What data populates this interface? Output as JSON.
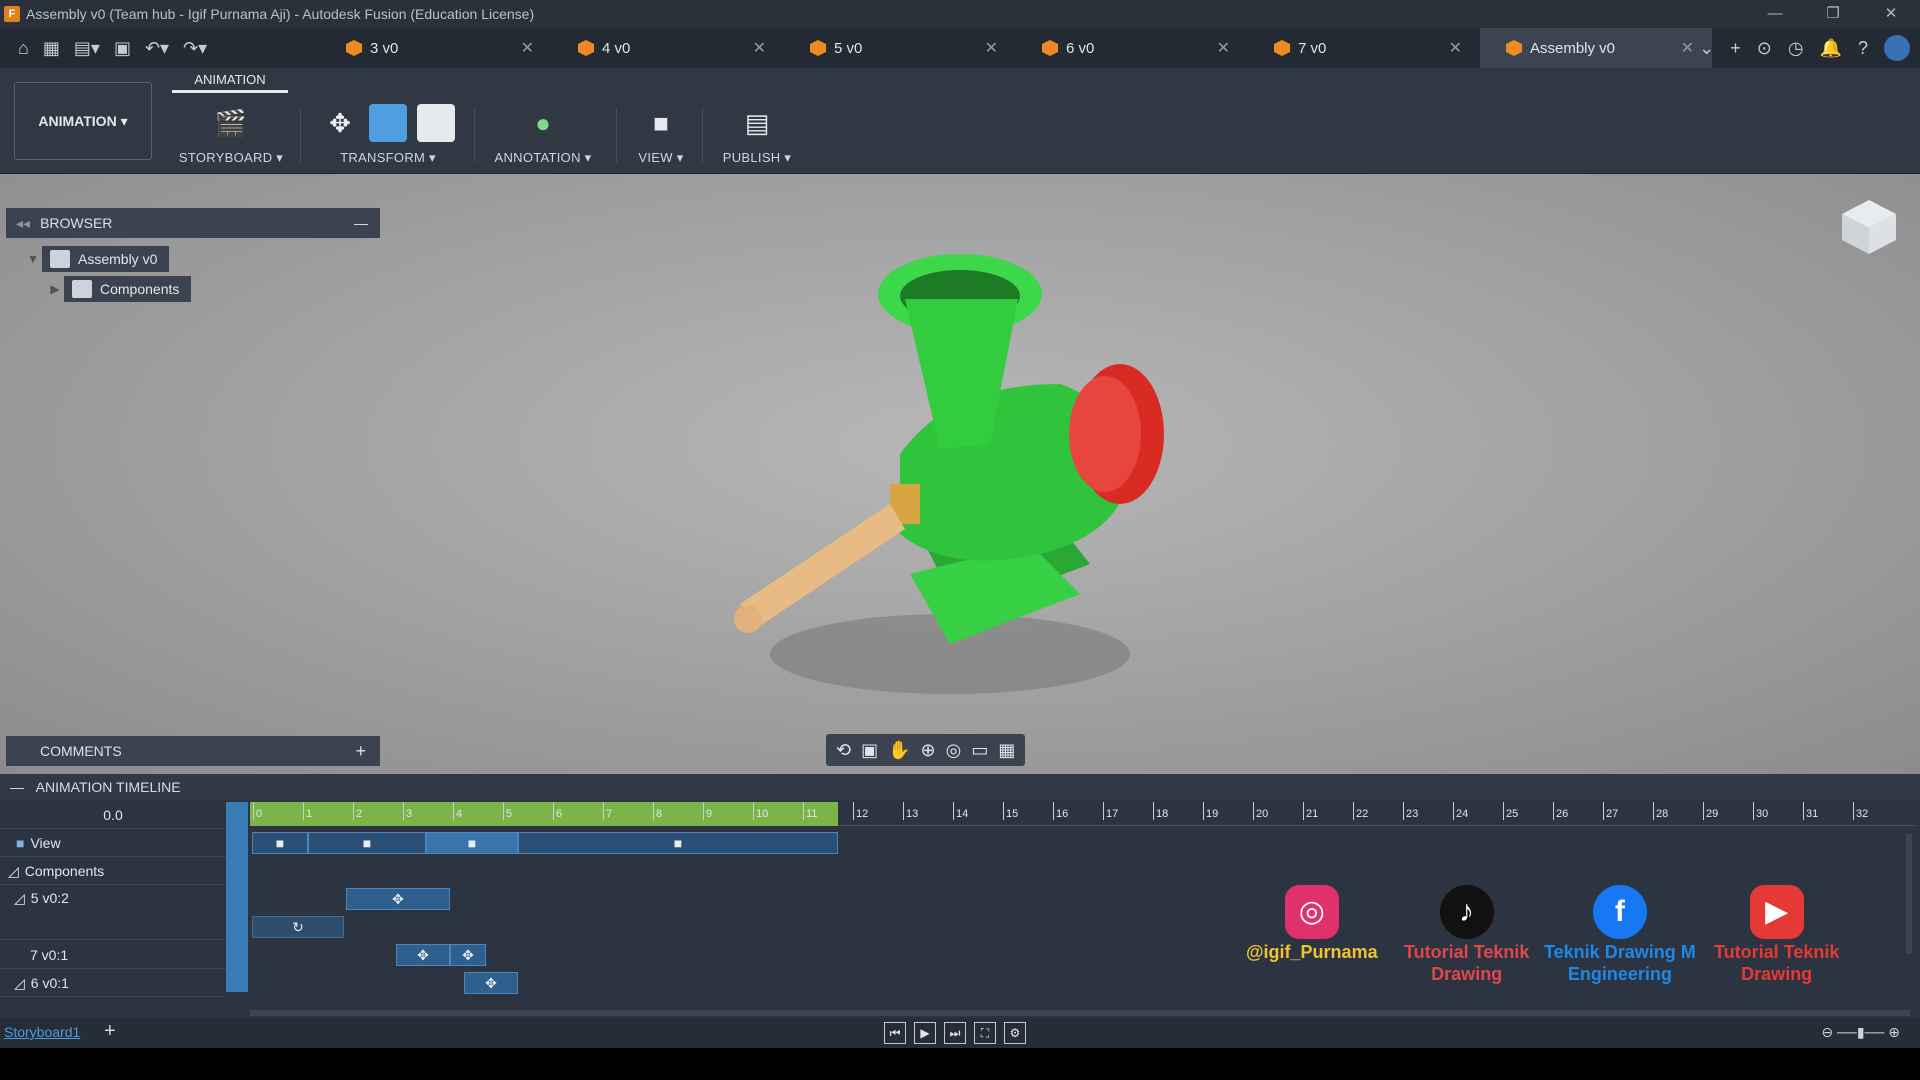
{
  "window": {
    "title": "Assembly v0 (Team hub - Igif Purnama Aji) - Autodesk Fusion (Education License)",
    "controls": [
      "—",
      "❐",
      "✕"
    ]
  },
  "tabs": [
    {
      "label": "3 v0",
      "active": false
    },
    {
      "label": "4 v0",
      "active": false
    },
    {
      "label": "5 v0",
      "active": false
    },
    {
      "label": "6 v0",
      "active": false
    },
    {
      "label": "7 v0",
      "active": false
    },
    {
      "label": "Assembly v0",
      "active": true
    }
  ],
  "ribbon": {
    "workspace": "ANIMATION",
    "active_tab": "ANIMATION",
    "groups": {
      "storyboard": "STORYBOARD",
      "transform": "TRANSFORM",
      "annotation": "ANNOTATION",
      "view": "VIEW",
      "publish": "PUBLISH"
    }
  },
  "browser": {
    "title": "BROWSER",
    "root": "Assembly v0",
    "child": "Components"
  },
  "comments": {
    "title": "COMMENTS",
    "add": "+"
  },
  "timeline": {
    "title": "ANIMATION TIMELINE",
    "time": "0.0",
    "rows": {
      "view": "View",
      "components": "Components",
      "c1": "5 v0:2",
      "c2": "7 v0:1",
      "c3": "6 v0:1"
    },
    "ruler_ticks": [
      "0",
      "1",
      "2",
      "3",
      "4",
      "5",
      "6",
      "7",
      "8",
      "9",
      "10",
      "11",
      "12",
      "13",
      "14",
      "15",
      "16",
      "17",
      "18",
      "19",
      "20",
      "21",
      "22",
      "23",
      "24",
      "25",
      "26",
      "27",
      "28",
      "29",
      "30",
      "31",
      "32"
    ],
    "storyboard": "Storyboard1"
  },
  "social": {
    "instagram": "@igif_Purnama",
    "tiktok_1": "Tutorial Teknik",
    "tiktok_2": "Drawing",
    "facebook_1": "Teknik Drawing M",
    "facebook_2": "Engineering",
    "youtube_1": "Tutorial Teknik",
    "youtube_2": "Drawing"
  },
  "colors": {
    "instagram": "#e1306c",
    "tiktok_text": "#e0474c",
    "facebook": "#1877f2",
    "youtube": "#e53935",
    "green_body": "#2fc83a",
    "red_knob": "#e3322b",
    "handle": "#e8b980"
  }
}
